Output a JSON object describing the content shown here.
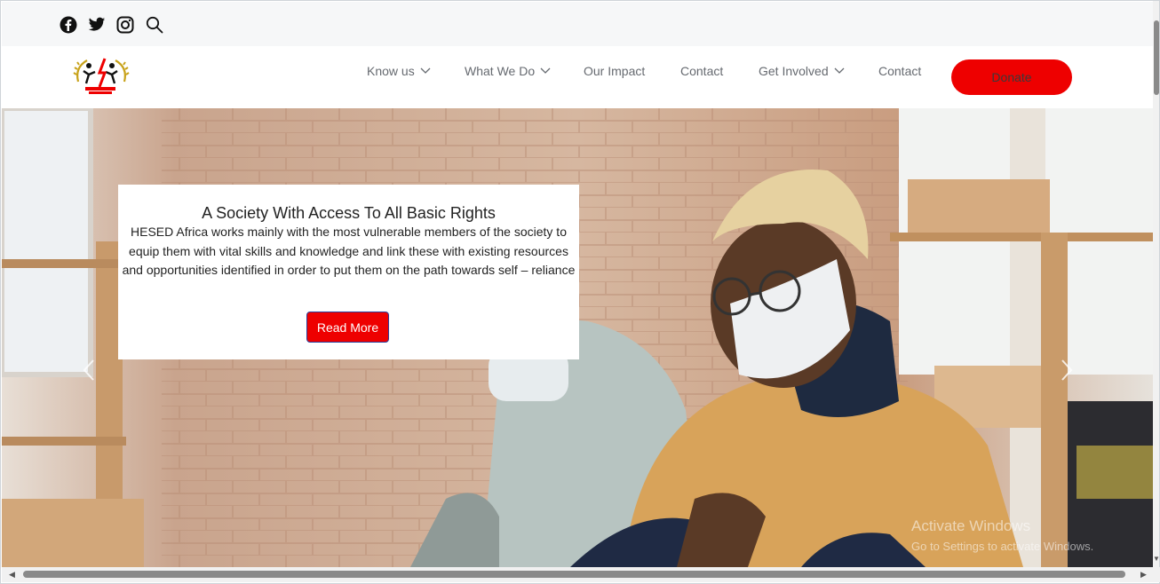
{
  "social": {
    "icons": [
      "facebook-icon",
      "twitter-icon",
      "instagram-icon",
      "search-icon"
    ]
  },
  "nav": {
    "items": [
      {
        "label": "Know us",
        "dropdown": true
      },
      {
        "label": "What We Do",
        "dropdown": true
      },
      {
        "label": "Our Impact",
        "dropdown": false
      },
      {
        "label": "Contact",
        "dropdown": false
      },
      {
        "label": "Get Involved",
        "dropdown": true
      },
      {
        "label": "Contact",
        "dropdown": false
      }
    ],
    "donate_label": "Donate"
  },
  "hero": {
    "title": "A Society With Access To All Basic Rights",
    "body": "HESED Africa works mainly with the most vulnerable members of the society to equip them with vital skills and knowledge and link these with existing resources and opportunities identified in order to put them on the path towards self – reliance",
    "cta_label": "Read More",
    "watermark_title": "Activate Windows",
    "watermark_sub": "Go to Settings to activate Windows."
  },
  "colors": {
    "accent": "#ee0000",
    "topbar_bg": "#f6f7f8",
    "nav_text": "#666a70"
  }
}
